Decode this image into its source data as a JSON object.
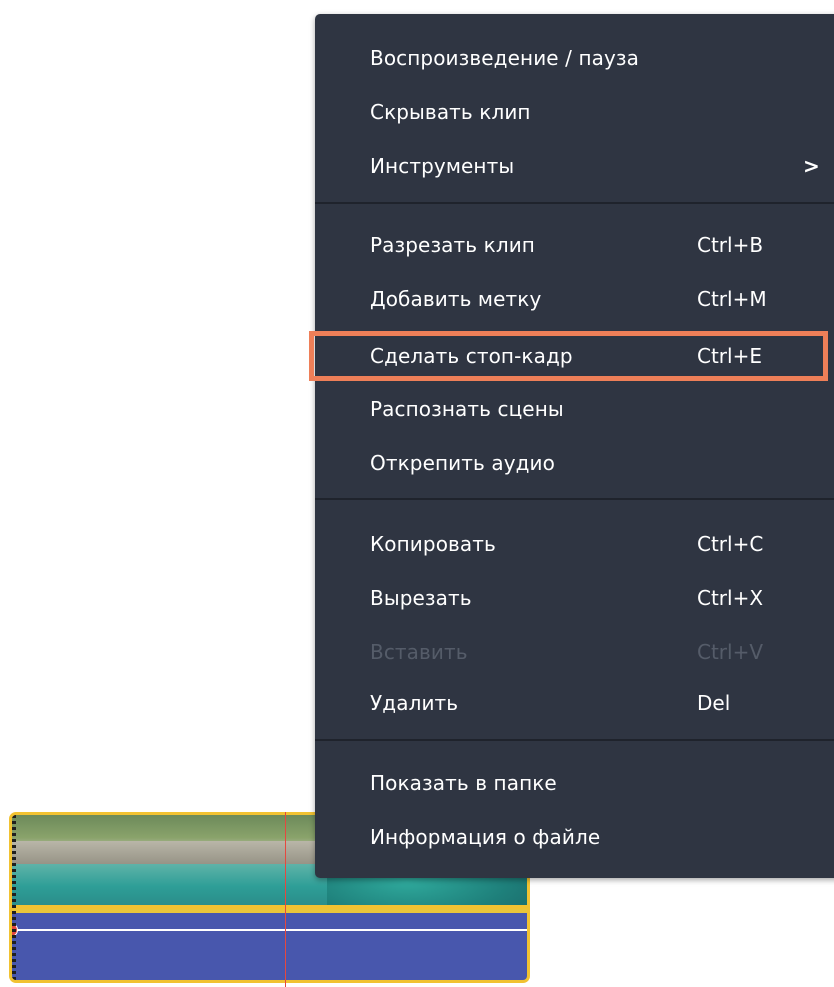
{
  "context_menu": {
    "groups": [
      {
        "items": [
          {
            "label": "Воспроизведение / пауза",
            "shortcut": ""
          },
          {
            "label": "Скрывать клип",
            "shortcut": ""
          },
          {
            "label": "Инструменты",
            "shortcut": "",
            "submenu_arrow": ">"
          }
        ]
      },
      {
        "items": [
          {
            "label": "Разрезать клип",
            "shortcut": "Ctrl+B"
          },
          {
            "label": "Добавить метку",
            "shortcut": "Ctrl+M"
          },
          {
            "label": "Сделать стоп-кадр",
            "shortcut": "Ctrl+E",
            "highlighted": true
          },
          {
            "label": "Распознать сцены",
            "shortcut": ""
          },
          {
            "label": "Открепить аудио",
            "shortcut": ""
          }
        ]
      },
      {
        "items": [
          {
            "label": "Копировать",
            "shortcut": "Ctrl+C"
          },
          {
            "label": "Вырезать",
            "shortcut": "Ctrl+X"
          },
          {
            "label": "Вставить",
            "shortcut": "Ctrl+V",
            "disabled": true
          },
          {
            "label": "Удалить",
            "shortcut": "Del"
          }
        ]
      },
      {
        "items": [
          {
            "label": "Показать в папке",
            "shortcut": ""
          },
          {
            "label": "Информация о файле",
            "shortcut": ""
          }
        ]
      }
    ]
  },
  "colors": {
    "menu_background": "#2f3542",
    "menu_text": "#ffffff",
    "menu_text_disabled": "#555c69",
    "highlight_border": "#ee7f58",
    "clip_border": "#f1c232",
    "audio_track": "#4857ad",
    "playhead": "#e5483f"
  }
}
